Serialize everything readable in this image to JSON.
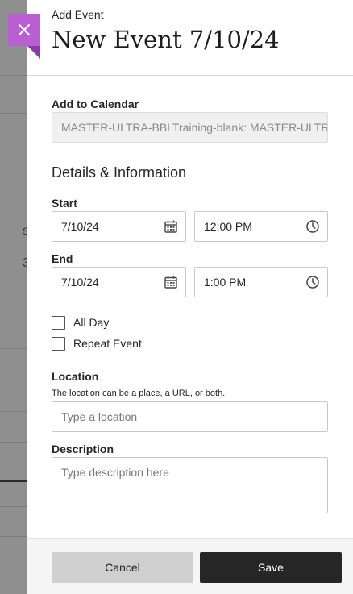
{
  "backdrop": {
    "fragments": [
      "s",
      "3"
    ]
  },
  "panel": {
    "eyebrow": "Add Event",
    "title": "New Event 7/10/24",
    "close_icon": "close-icon",
    "accent_color": "#b95fd1"
  },
  "calendar": {
    "label": "Add to Calendar",
    "value": "MASTER-ULTRA-BBLTraining-blank: MASTER-ULTRA"
  },
  "details": {
    "heading": "Details & Information"
  },
  "start": {
    "label": "Start",
    "date": "7/10/24",
    "time": "12:00 PM"
  },
  "end": {
    "label": "End",
    "date": "7/10/24",
    "time": "1:00 PM"
  },
  "options": {
    "all_day": "All Day",
    "repeat": "Repeat Event"
  },
  "location": {
    "label": "Location",
    "hint": "The location can be a place, a URL, or both.",
    "placeholder": "Type a location"
  },
  "description": {
    "label": "Description",
    "placeholder": "Type description here"
  },
  "footer": {
    "cancel": "Cancel",
    "save": "Save"
  }
}
